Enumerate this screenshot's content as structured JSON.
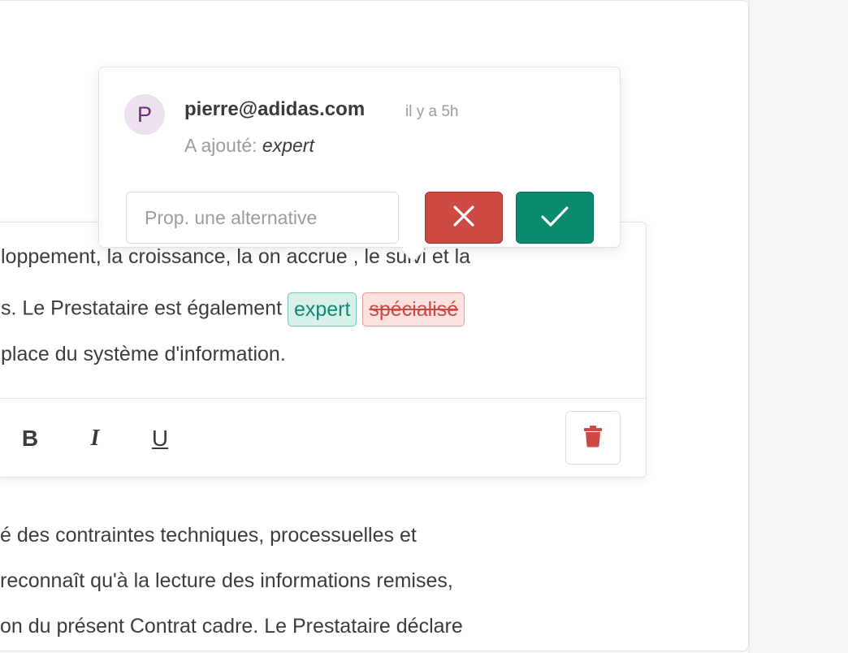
{
  "editor": {
    "lines": [
      {
        "text": "loppement, la croissance, la on accrue , le suivi  et la"
      },
      {
        "before": "s. Le Prestataire est également ",
        "added": "expert",
        "removed": "spécialisé"
      },
      {
        "text": " place du système d'information."
      }
    ],
    "toolbar": {
      "bold": "B",
      "italic": "I",
      "underline": "U"
    }
  },
  "body_text": [
    "é des contraintes techniques, processuelles et",
    " reconnaît qu'à la lecture des informations remises,",
    "on du présent Contrat cadre. Le Prestataire déclare"
  ],
  "popover": {
    "avatar_initial": "P",
    "author": "pierre@adidas.com",
    "time": "il y a 5h",
    "action_label": "A ajouté:",
    "action_word": "expert",
    "alternative_placeholder": "Prop. une alternative"
  },
  "icons": {
    "reject": "close-icon",
    "accept": "check-icon",
    "delete": "trash-icon"
  },
  "colors": {
    "accept": "#0c8a70",
    "reject": "#cd4943",
    "added_bg": "#d9efe9",
    "removed_bg": "#fbe1e0",
    "avatar_bg": "#ece2ee",
    "avatar_text": "#6b2a7a"
  }
}
